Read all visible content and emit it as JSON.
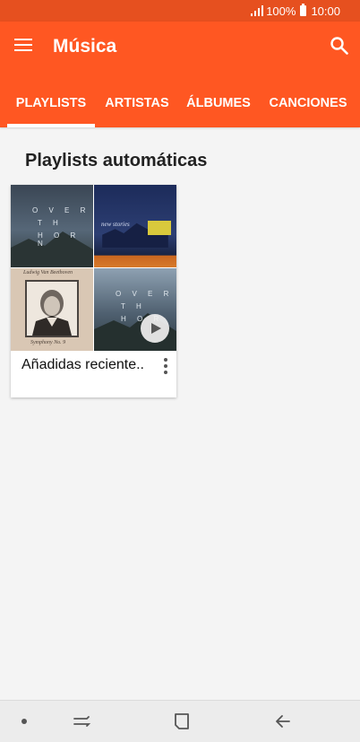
{
  "status_bar": {
    "battery_percent": "100%",
    "time": "10:00",
    "icons": [
      "signal-icon",
      "battery-icon"
    ]
  },
  "app_bar": {
    "title": "Música",
    "icons": [
      "menu-icon",
      "search-icon"
    ],
    "background": "#ff5722",
    "status_background": "#e6501f"
  },
  "tabs": [
    {
      "label": "PLAYLISTS",
      "active": true
    },
    {
      "label": "ARTISTAS",
      "active": false
    },
    {
      "label": "ÁLBUMES",
      "active": false
    },
    {
      "label": "CANCIONES",
      "active": false
    }
  ],
  "section": {
    "title": "Playlists automáticas"
  },
  "playlists": [
    {
      "title": "Añadidas reciente..",
      "cover_text": {
        "top_left": [
          "O V E R",
          "T H",
          "H O R N"
        ],
        "top_right": "new stories",
        "bottom_left_top": "Ludwig Van Beethoven",
        "bottom_left_bottom": "Symphony No. 9",
        "bottom_right": [
          "O V E R",
          "T H",
          "H O R"
        ]
      },
      "icons": [
        "play-icon",
        "more-vert-icon"
      ]
    }
  ],
  "nav_bar": {
    "icons": [
      "nav-dot-icon",
      "recent-apps-icon",
      "home-icon",
      "back-icon"
    ]
  }
}
